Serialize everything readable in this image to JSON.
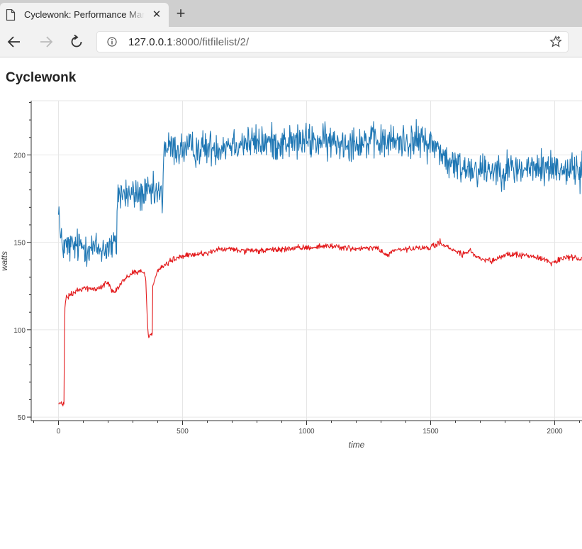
{
  "browser": {
    "tab_title": "Cyclewonk: Performance Management",
    "url_host": "127.0.0.1",
    "url_rest": ":8000/fitfilelist/2/"
  },
  "page": {
    "title": "Cyclewonk"
  },
  "chart_data": {
    "type": "line",
    "title": "",
    "xlabel": "time",
    "ylabel": "watts",
    "xlim": [
      -110,
      2110
    ],
    "ylim": [
      48,
      231
    ],
    "xticks": [
      0,
      500,
      1000,
      1500,
      2000
    ],
    "yticks": [
      50,
      100,
      150,
      200
    ],
    "grid": true,
    "legend": "none",
    "series": [
      {
        "color": "#1f77b4",
        "noise": 5,
        "points": [
          [
            0,
            175
          ],
          [
            8,
            150
          ],
          [
            30,
            147
          ],
          [
            100,
            148
          ],
          [
            160,
            146
          ],
          [
            234,
            148
          ],
          [
            237,
            178
          ],
          [
            300,
            177
          ],
          [
            400,
            178
          ],
          [
            420,
            175
          ],
          [
            424,
            204
          ],
          [
            500,
            203
          ],
          [
            600,
            204
          ],
          [
            650,
            205
          ],
          [
            700,
            207
          ],
          [
            800,
            207
          ],
          [
            900,
            207
          ],
          [
            1000,
            208
          ],
          [
            1100,
            207
          ],
          [
            1200,
            208
          ],
          [
            1300,
            207
          ],
          [
            1400,
            208
          ],
          [
            1480,
            208
          ],
          [
            1500,
            206
          ],
          [
            1540,
            203
          ],
          [
            1560,
            197
          ],
          [
            1580,
            194
          ],
          [
            1700,
            192
          ],
          [
            1800,
            192
          ],
          [
            1900,
            192
          ],
          [
            2000,
            193
          ],
          [
            2110,
            191
          ]
        ]
      },
      {
        "color": "#e31a1c",
        "noise": 0.8,
        "points": [
          [
            0,
            58
          ],
          [
            22,
            57
          ],
          [
            25,
            112
          ],
          [
            30,
            118
          ],
          [
            60,
            121
          ],
          [
            100,
            124
          ],
          [
            150,
            123
          ],
          [
            200,
            127
          ],
          [
            220,
            122
          ],
          [
            240,
            124
          ],
          [
            260,
            128
          ],
          [
            300,
            133
          ],
          [
            340,
            133
          ],
          [
            350,
            131
          ],
          [
            352,
            128
          ],
          [
            360,
            100
          ],
          [
            365,
            95
          ],
          [
            370,
            98
          ],
          [
            375,
            97
          ],
          [
            378,
            98
          ],
          [
            380,
            126
          ],
          [
            400,
            134
          ],
          [
            430,
            137
          ],
          [
            460,
            140
          ],
          [
            500,
            142
          ],
          [
            550,
            143
          ],
          [
            600,
            144
          ],
          [
            650,
            146
          ],
          [
            700,
            146
          ],
          [
            750,
            145
          ],
          [
            800,
            145
          ],
          [
            900,
            146
          ],
          [
            1000,
            147
          ],
          [
            1100,
            148
          ],
          [
            1150,
            147
          ],
          [
            1200,
            146
          ],
          [
            1280,
            147
          ],
          [
            1300,
            145
          ],
          [
            1330,
            142
          ],
          [
            1340,
            145
          ],
          [
            1400,
            146
          ],
          [
            1500,
            147
          ],
          [
            1540,
            150
          ],
          [
            1560,
            148
          ],
          [
            1580,
            146
          ],
          [
            1600,
            145
          ],
          [
            1630,
            143
          ],
          [
            1660,
            145
          ],
          [
            1700,
            140
          ],
          [
            1750,
            139
          ],
          [
            1800,
            143
          ],
          [
            1850,
            143
          ],
          [
            1900,
            142
          ],
          [
            1950,
            141
          ],
          [
            1990,
            138
          ],
          [
            2030,
            141
          ],
          [
            2110,
            141
          ]
        ]
      }
    ]
  }
}
